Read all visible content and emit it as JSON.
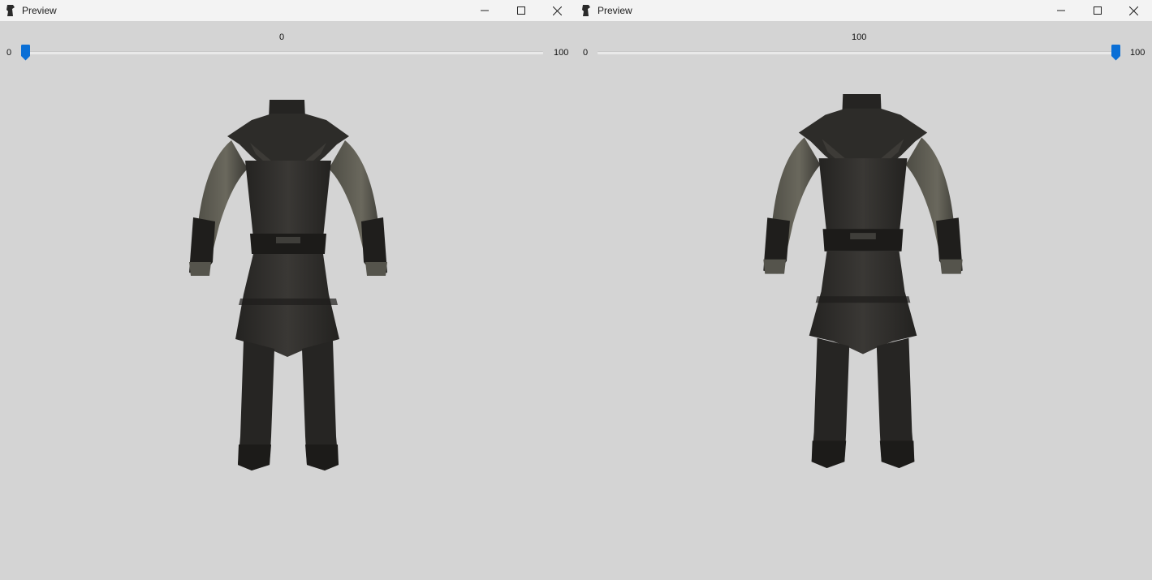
{
  "windows": [
    {
      "title": "Preview",
      "slider": {
        "value_label": "0",
        "min_label": "0",
        "max_label": "100",
        "value": 0
      },
      "icons": [
        "app-icon",
        "minimize-icon",
        "maximize-icon",
        "close-icon",
        "slider-thumb-icon"
      ]
    },
    {
      "title": "Preview",
      "slider": {
        "value_label": "100",
        "min_label": "0",
        "max_label": "100",
        "value": 100
      },
      "icons": [
        "app-icon",
        "minimize-icon",
        "maximize-icon",
        "close-icon",
        "slider-thumb-icon"
      ]
    }
  ],
  "colors": {
    "background": "#d4d4d4",
    "titlebar": "#f3f3f3",
    "slider_accent": "#0a6fd6",
    "armor_dark": "#2b2a28",
    "armor_sleeve": "#5b5a51"
  }
}
